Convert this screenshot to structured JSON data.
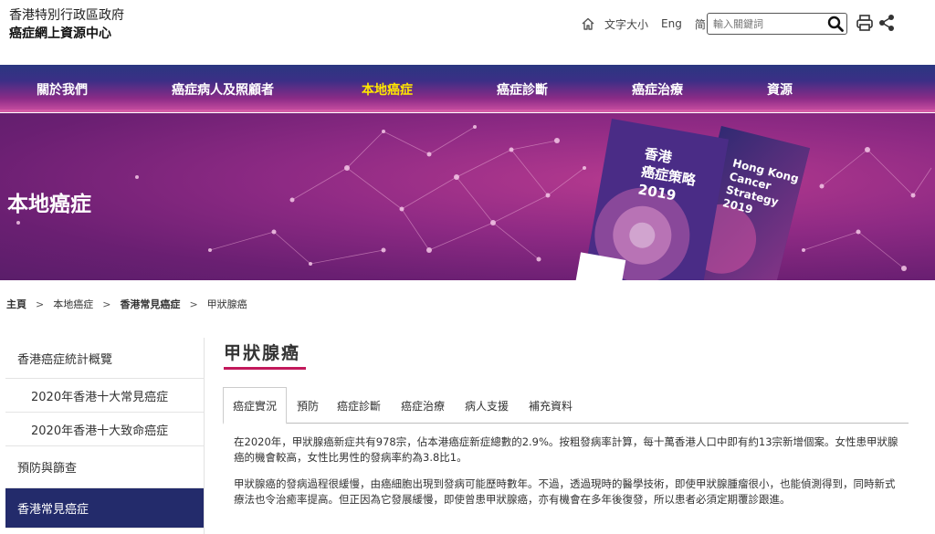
{
  "header": {
    "org_line1": "香港特別行政區政府",
    "org_line2": "癌症網上資源中心",
    "tools": {
      "font_size": "文字大小",
      "english": "Eng",
      "simplified": "简"
    },
    "search_placeholder": "輸入關鍵詞"
  },
  "nav": {
    "items": [
      {
        "label": "關於我們"
      },
      {
        "label": "癌症病人及照顧者"
      },
      {
        "label": "本地癌症"
      },
      {
        "label": "癌症診斷"
      },
      {
        "label": "癌症治療"
      },
      {
        "label": "資源"
      }
    ],
    "active_index": 2
  },
  "banner": {
    "title": "本地癌症",
    "book1_title": "香港\n癌症策略\n2019",
    "book2_title": "Hong Kong\nCancer\nStrategy\n2019"
  },
  "breadcrumb": [
    "主頁",
    "本地癌症",
    "香港常見癌症",
    "甲狀腺癌"
  ],
  "sidebar": {
    "items": [
      {
        "label": "香港癌症統計概覽"
      },
      {
        "label": "2020年香港十大常見癌症"
      },
      {
        "label": "2020年香港十大致命癌症"
      },
      {
        "label": "預防與篩查"
      },
      {
        "label": "香港常見癌症"
      }
    ]
  },
  "content": {
    "title": "甲狀腺癌",
    "tabs": [
      {
        "label": "癌症實況"
      },
      {
        "label": "預防"
      },
      {
        "label": "癌症診斷"
      },
      {
        "label": "癌症治療"
      },
      {
        "label": "病人支援"
      },
      {
        "label": "補充資料"
      }
    ],
    "paragraphs": [
      "在2020年，甲狀腺癌新症共有978宗，佔本港癌症新症總數的2.9%。按粗發病率計算，每十萬香港人口中即有約13宗新增個案。女性患甲狀腺癌的機會較高，女性比男性的發病率約為3.8比1。",
      "甲狀腺癌的發病過程很緩慢，由癌細胞出現到發病可能歷時數年。不過，透過現時的醫學技術，即使甲狀腺腫瘤很小，也能偵測得到，同時新式療法也令治癒率提高。但正因為它發展緩慢，即使曾患甲狀腺癌，亦有機會在多年後復發，所以患者必須定期覆診跟進。"
    ]
  },
  "colors": {
    "nav_active": "#ffe600",
    "sidebar_active_bg": "#232b6b",
    "title_underline": "#c2185b"
  },
  "icons": [
    "home-icon",
    "search-icon",
    "print-icon",
    "share-icon"
  ]
}
